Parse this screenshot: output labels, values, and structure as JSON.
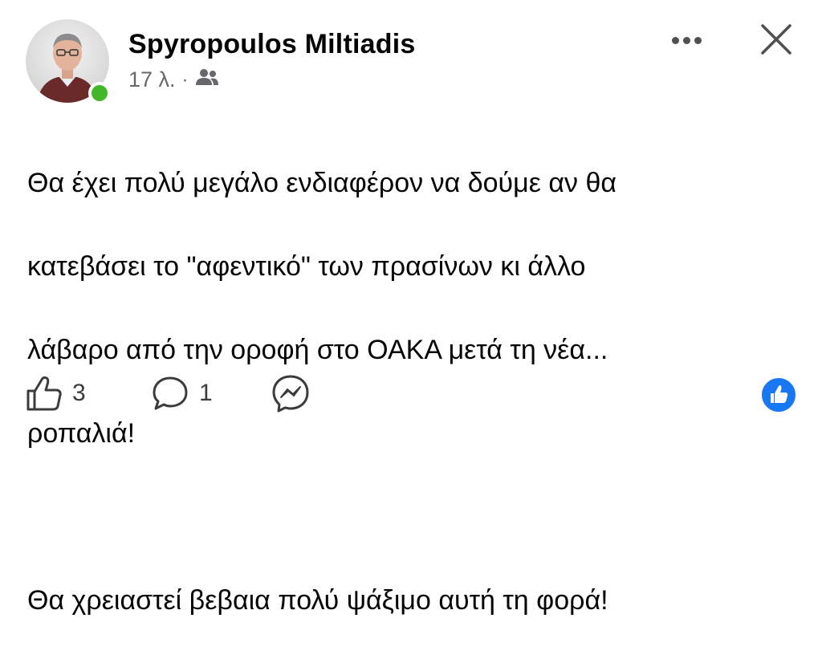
{
  "post": {
    "author": "Spyropoulos Miltiadis",
    "time": "17 λ.",
    "separator": "·",
    "audience_icon": "friends-icon",
    "text_lines": [
      "Θα έχει πολύ μεγάλο ενδιαφέρον να δούμε αν θα",
      "κατεβάσει το \"αφεντικό\" των πρασίνων κι άλλο",
      "λάβαρο από την οροφή στο ΟΑΚΑ  μετά τη νέα...",
      "ροπαλιά!",
      "",
      "Θα χρειαστεί βεβαια πολύ ψάξιμο αυτή τη φορά!"
    ]
  },
  "actions": {
    "like_count": "3",
    "comment_count": "1"
  },
  "icons": {
    "more": "more-options-icon",
    "close": "close-icon",
    "like": "thumbs-up-icon",
    "comment": "comment-icon",
    "messenger": "messenger-icon",
    "reaction": "like-reaction-icon"
  },
  "colors": {
    "online": "#42b72a",
    "reaction_blue": "#1877f2",
    "meta_gray": "#65676b"
  }
}
